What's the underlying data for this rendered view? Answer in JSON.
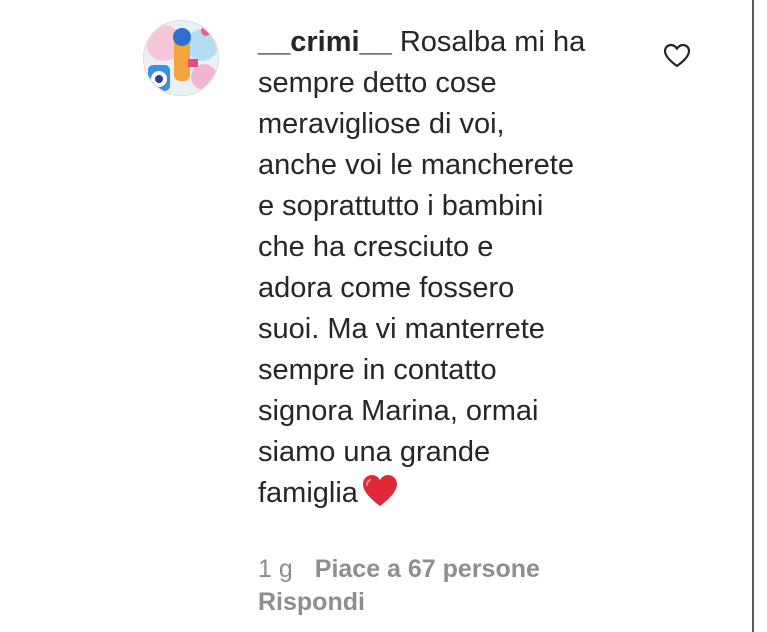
{
  "comment": {
    "username": "__crimi__",
    "lines": [
      "Rosalba mi ha",
      "sempre detto cose",
      "meravigliose di voi,",
      "anche voi le mancherete",
      "e soprattutto i bambini",
      "che ha cresciuto e",
      "adora come fossero",
      "suoi. Ma vi manterrete",
      "sempre in contatto",
      "signora Marina, ormai",
      "siamo una grande",
      "famiglia"
    ],
    "emoji": "red-heart-emoji",
    "time": "1 g",
    "likes_label": "Piace a 67 persone",
    "reply_label": "Rispondi",
    "like_icon": "heart-outline-icon"
  },
  "colors": {
    "text": "#262626",
    "secondary": "#8e8e8e",
    "heart": "#e0283a"
  }
}
